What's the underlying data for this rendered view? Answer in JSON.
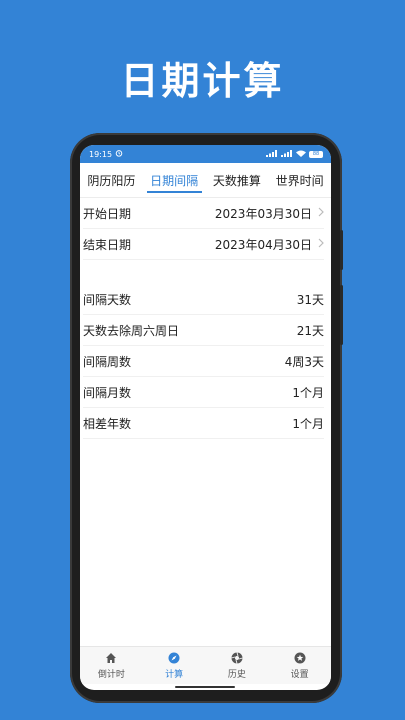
{
  "promo": {
    "title": "日期计算"
  },
  "status_bar": {
    "time": "19:15",
    "battery": "88"
  },
  "tabs": [
    {
      "label": "阴历阳历"
    },
    {
      "label": "日期间隔"
    },
    {
      "label": "天数推算"
    },
    {
      "label": "世界时间"
    }
  ],
  "active_tab": "日期间隔",
  "date_inputs": [
    {
      "label": "开始日期",
      "value": "2023年03月30日"
    },
    {
      "label": "结束日期",
      "value": "2023年04月30日"
    }
  ],
  "results": [
    {
      "label": "间隔天数",
      "value": "31天"
    },
    {
      "label": "天数去除周六周日",
      "value": "21天"
    },
    {
      "label": "间隔周数",
      "value": "4周3天"
    },
    {
      "label": "间隔月数",
      "value": "1个月"
    },
    {
      "label": "相差年数",
      "value": "1个月"
    }
  ],
  "bottom_nav": [
    {
      "label": "倒计时",
      "icon": "home-icon"
    },
    {
      "label": "计算",
      "icon": "compass-icon"
    },
    {
      "label": "历史",
      "icon": "aperture-icon"
    },
    {
      "label": "设置",
      "icon": "star-icon"
    }
  ],
  "active_nav": "计算",
  "colors": {
    "brand": "#3383d6",
    "text": "#222222",
    "divider": "#f0f0f0"
  }
}
